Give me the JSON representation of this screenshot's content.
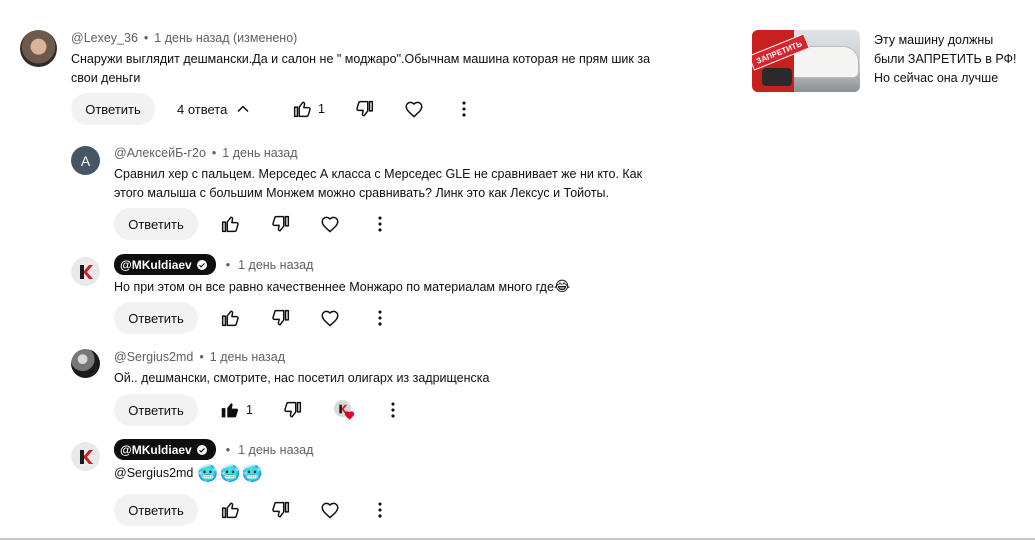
{
  "top_comment": {
    "author": "@Lexey_36",
    "time": "1 день назад (изменено)",
    "text": "Снаружи выглядит дешмански.Да и салон не \" моджаро\".Обычнам машина которая не прям шик за свои деньги",
    "reply_label": "Ответить",
    "replies_toggle": "4 ответа",
    "likes": "1"
  },
  "replies": [
    {
      "author": "@АлексейБ-г2о",
      "avatar_letter": "А",
      "time": "1 день назад",
      "text": "Сравнил хер с пальцем. Мерседес А класса с Мерседес GLE не сравнивает же ни кто. Как этого малыша с большим Монжем можно сравнивать? Линк это как Лексус и Тойоты.",
      "reply_label": "Ответить"
    },
    {
      "author": "@MKuldiaev",
      "time": "1 день назад",
      "text": "Но при этом он все равно качественнее Монжаро по материалам много где",
      "emoji": "😂",
      "reply_label": "Ответить"
    },
    {
      "author": "@Sergius2md",
      "time": "1 день назад",
      "text": "Ой.. дешмански, смотрите, нас посетил олигарх из задрищенска",
      "reply_label": "Ответить",
      "likes": "1"
    },
    {
      "author": "@MKuldiaev",
      "time": "1 день назад",
      "text": "@Sergius2md",
      "emoji": "🥶🥶🥶",
      "reply_label": "Ответить"
    }
  ],
  "sidebar_video": {
    "thumb_text": "ЗАПРЕТИТЬ",
    "title": "Эту машину должны были ЗАПРЕТИТЬ в РФ! Но сейчас она лучше Кулрея ..."
  },
  "colors": {
    "meta": "#606060",
    "chip": "#f2f2f2",
    "badge": "#0f0f0f",
    "heart_red": "#e0002a",
    "thumb_red": "#d8262f"
  },
  "icons": {
    "like": "thumbs-up-icon",
    "dislike": "thumbs-down-icon",
    "heart": "heart-icon",
    "more": "more-vertical-icon",
    "chevron": "chevron-up-icon",
    "verified": "verified-check-icon"
  }
}
